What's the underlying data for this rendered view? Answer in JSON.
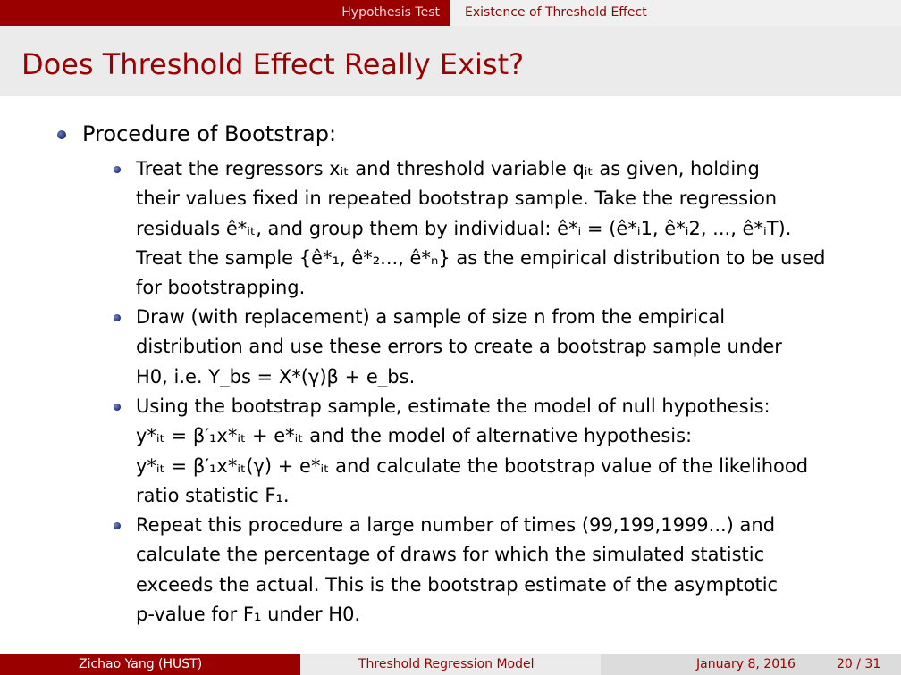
{
  "nav": {
    "section_left": "Hypothesis Test",
    "section_right": "Existence of Threshold Effect"
  },
  "slide": {
    "title": "Does Threshold Effect Really Exist?",
    "heading": "Procedure of Bootstrap:",
    "items": [
      {
        "lines": [
          "Treat the regressors xᵢₜ and threshold variable qᵢₜ as given, holding",
          "their values fixed in repeated bootstrap sample. Take the regression",
          "residuals ê*ᵢₜ, and group them by individual: ê*ᵢ = (ê*ᵢ1, ê*ᵢ2, ..., ê*ᵢT).",
          "Treat the sample {ê*₁, ê*₂..., ê*ₙ} as the empirical distribution to be used",
          "for bootstrapping."
        ]
      },
      {
        "lines": [
          "Draw (with replacement) a sample of size n from the empirical",
          "distribution and use these errors to create a bootstrap sample under",
          "H0, i.e. Y_bs = X*(γ)β + e_bs."
        ]
      },
      {
        "lines": [
          "Using the bootstrap sample, estimate the model of null hypothesis:",
          "y*ᵢₜ = β′₁x*ᵢₜ + e*ᵢₜ and the model of alternative hypothesis:",
          "y*ᵢₜ = β′₁x*ᵢₜ(γ) + e*ᵢₜ and calculate the bootstrap value of the likelihood",
          "ratio statistic F₁."
        ]
      },
      {
        "lines": [
          "Repeat this procedure a large number of times (99,199,1999...) and",
          "calculate the percentage of draws for which the simulated statistic",
          "exceeds the actual. This is the bootstrap estimate of the asymptotic",
          "p-value for F₁ under H0."
        ]
      }
    ]
  },
  "footer": {
    "author": "Zichao Yang (HUST)",
    "talk_title": "Threshold Regression Model",
    "date": "January 8, 2016",
    "page": "20 / 31"
  },
  "colors": {
    "accent": "#9b0000",
    "title_bar": "#ebebeb",
    "bullet": "#233174"
  }
}
